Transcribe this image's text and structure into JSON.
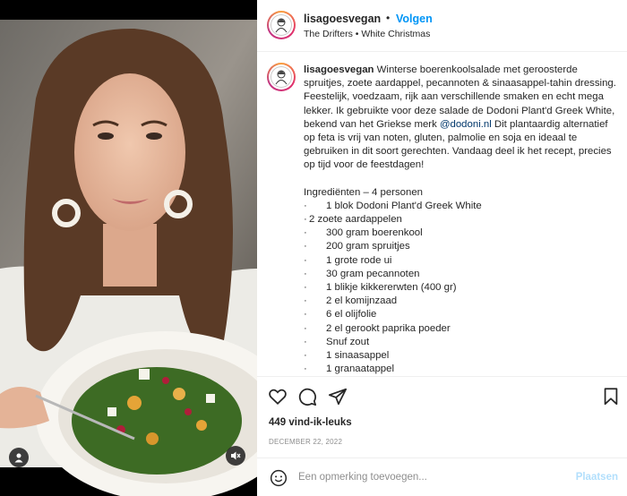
{
  "post": {
    "username": "lisagoesvegan",
    "follow_label": "Volgen",
    "separator": "•",
    "audio": "The Drifters • White Christmas"
  },
  "caption": {
    "username": "lisagoesvegan",
    "text_before_mention": " Winterse boerenkoolsalade met geroosterde spruitjes, zoete aardappel, pecannoten & sinaasappel-tahin dressing. Feestelijk, voedzaam, rijk aan verschillende smaken en echt mega lekker. Ik gebruikte voor deze salade de Dodoni Plant'd Greek White, bekend van het Griekse merk ",
    "mention": "@dodoni.nl",
    "text_after_mention": " Dit plantaardig alternatief op feta is vrij van noten, gluten, palmolie en soja en ideaal te gebruiken in dit soort gerechten. Vandaag deel ik het recept, precies op tijd voor de feestdagen!",
    "ingredients_title": "Ingrediënten – 4 personen",
    "ingredients": [
      {
        "bullet": "·",
        "text": "1 blok Dodoni Plant'd Greek White"
      },
      {
        "bullet": "·",
        "text": "2 zoete aardappelen",
        "tight": true
      },
      {
        "bullet": "·",
        "text": "300 gram boerenkool"
      },
      {
        "bullet": "·",
        "text": "200 gram spruitjes"
      },
      {
        "bullet": "·",
        "text": "1 grote rode ui"
      },
      {
        "bullet": "·",
        "text": "30 gram pecannoten"
      },
      {
        "bullet": "·",
        "text": "1 blikje kikkererwten (400 gr)"
      },
      {
        "bullet": "·",
        "text": "2 el komijnzaad"
      },
      {
        "bullet": "·",
        "text": "6 el olijfolie"
      },
      {
        "bullet": "·",
        "text": "2 el gerookt paprika poeder"
      },
      {
        "bullet": "·",
        "text": "Snuf zout"
      },
      {
        "bullet": "·",
        "text": "1 sinaasappel"
      },
      {
        "bullet": "·",
        "text": "1 granaatappel"
      }
    ]
  },
  "stats": {
    "likes": "449 vind-ik-leuks",
    "date": "DECEMBER 22, 2022"
  },
  "comment": {
    "placeholder": "Een opmerking toevoegen...",
    "post_label": "Plaatsen"
  },
  "icons": {
    "like": "heart-icon",
    "comment": "comment-icon",
    "share": "share-icon",
    "save": "bookmark-icon",
    "emoji": "emoji-icon",
    "user": "user-icon",
    "mute": "speaker-muted-icon"
  },
  "colors": {
    "link": "#0095f6",
    "mention": "#00376b",
    "muted": "#8e8e8e",
    "post_disabled": "#b2dffc"
  }
}
